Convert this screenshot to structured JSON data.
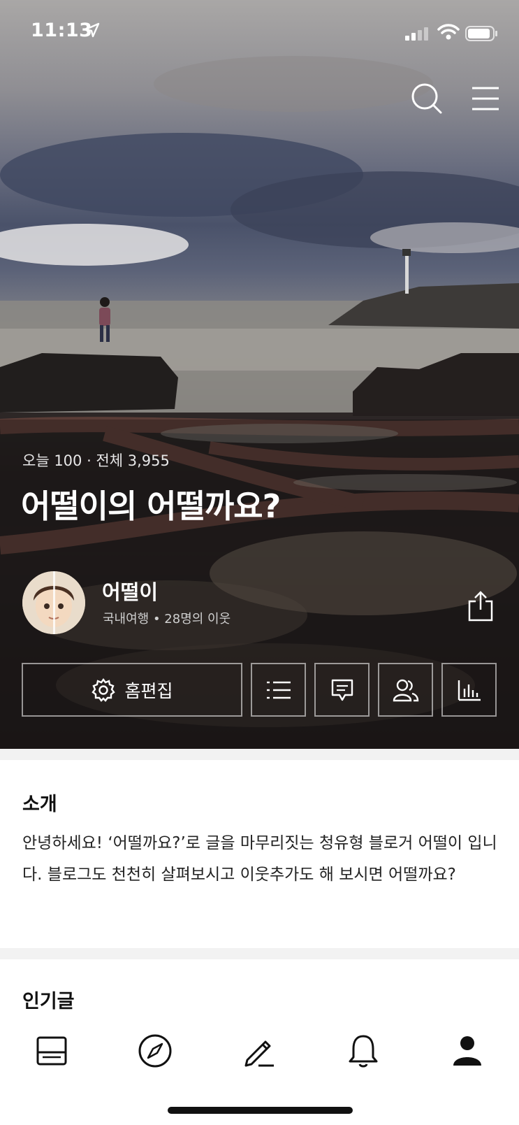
{
  "status_bar": {
    "time": "11:13"
  },
  "blog": {
    "counts": "오늘 100 · 전체 3,955",
    "title": "어떨이의 어떨까요?",
    "nickname": "어떨이",
    "meta": "국내여행 • 28명의 이웃"
  },
  "header_buttons": {
    "edit_label": "홈편집"
  },
  "intro": {
    "heading": "소개",
    "text": "안녕하세요! ‘어떨까요?’로 글을 마무리짓는 청유형 블로거 어떨이 입니다. 블로그도 천천히 살펴보시고 이웃추가도 해 보시면 어떨까요?"
  },
  "popular": {
    "heading": "인기글"
  },
  "icons": {
    "search": "search-icon",
    "menu": "hamburger-menu-icon",
    "share": "share-icon",
    "settings": "gear-icon",
    "list": "list-icon",
    "comment": "comment-icon",
    "neighbors": "people-icon",
    "stats": "bar-chart-icon",
    "tabs": [
      "feed-icon",
      "compass-icon",
      "pencil-icon",
      "bell-icon",
      "person-icon"
    ]
  }
}
